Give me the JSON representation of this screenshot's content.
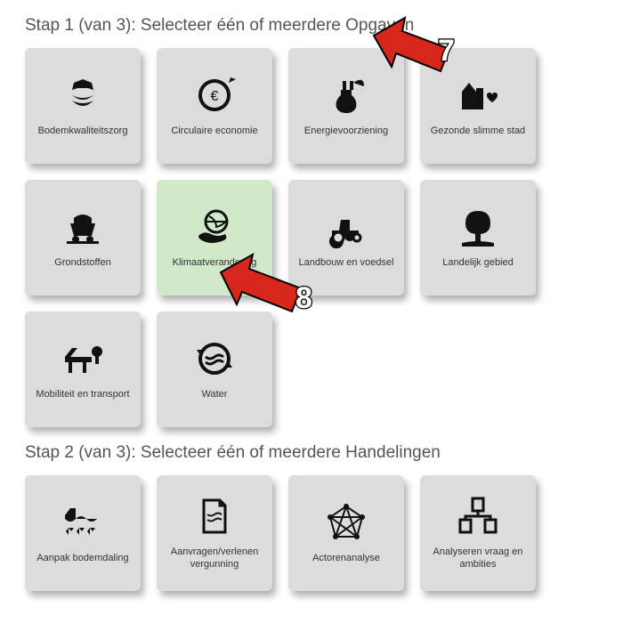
{
  "step1": {
    "title": "Stap 1 (van 3): Selecteer één of meerdere Opgaven",
    "tiles": [
      {
        "id": "bodemkwaliteitszorg",
        "label": "Bodemkwaliteitszorg",
        "icon": "soil-care",
        "selected": false
      },
      {
        "id": "circulaire-economie",
        "label": "Circulaire economie",
        "icon": "circular-euro",
        "selected": false
      },
      {
        "id": "energievoorziening",
        "label": "Energievoorziening",
        "icon": "energy-plug",
        "selected": false
      },
      {
        "id": "gezonde-slimme-stad",
        "label": "Gezonde slimme stad",
        "icon": "city-heart",
        "selected": false
      },
      {
        "id": "grondstoffen",
        "label": "Grondstoffen",
        "icon": "mine-cart",
        "selected": false
      },
      {
        "id": "klimaatverandering",
        "label": "Klimaatverandering",
        "icon": "globe-hand",
        "selected": true
      },
      {
        "id": "landbouw-en-voedsel",
        "label": "Landbouw en voedsel",
        "icon": "tractor",
        "selected": false
      },
      {
        "id": "landelijk-gebied",
        "label": "Landelijk gebied",
        "icon": "tree",
        "selected": false
      },
      {
        "id": "mobiliteit-en-transport",
        "label": "Mobiliteit en transport",
        "icon": "bridge-tree",
        "selected": false
      },
      {
        "id": "water",
        "label": "Water",
        "icon": "water-cycle",
        "selected": false
      }
    ]
  },
  "step2": {
    "title": "Stap 2 (van 3): Selecteer één of meerdere Handelingen",
    "tiles": [
      {
        "id": "aanpak-bodemdaling",
        "label": "Aanpak bodemdaling",
        "icon": "subsidence",
        "selected": false
      },
      {
        "id": "aanvragen-verlenen-vergunning",
        "label": "Aanvragen/verlenen vergunning",
        "icon": "document",
        "selected": false
      },
      {
        "id": "actorenanalyse",
        "label": "Actorenanalyse",
        "icon": "network",
        "selected": false
      },
      {
        "id": "analyseren-vraag-en-ambities",
        "label": "Analyseren vraag en ambities",
        "icon": "analyse-docs",
        "selected": false
      }
    ]
  },
  "annotations": {
    "a7": "7",
    "a8": "8"
  }
}
